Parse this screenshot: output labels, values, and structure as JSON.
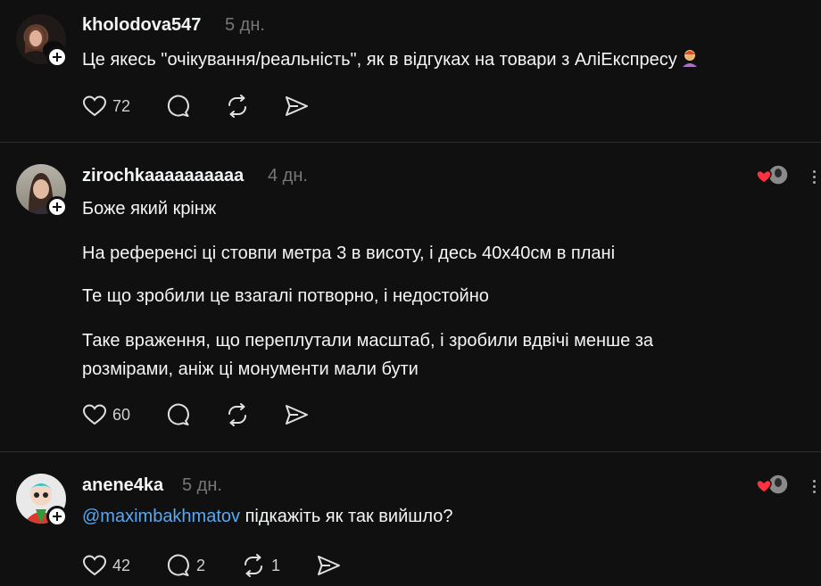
{
  "comments": [
    {
      "username": "kholodova547",
      "time": "5 дн.",
      "paragraphs": [
        "Це якесь \"очікування/реальність\", як в відгуках на товари з АліЕкспресу"
      ],
      "emoji": "facepalm-emoji",
      "likes": "72",
      "replies": "",
      "reposts": ""
    },
    {
      "username": "zirochkaaaaaaaaaa",
      "time": "4 дн.",
      "paragraphs": [
        "Боже який крінж",
        "На референсі ці стовпи метра 3 в висоту, і десь 40х40см в плані",
        "Те що зробили це взагалі потворно, і недостойно",
        "Таке враження, що переплутали масштаб, і зробили вдвічі менше за",
        "розмірами, аніж ці монументи мали бути"
      ],
      "likes": "60",
      "replies": "",
      "reposts": ""
    },
    {
      "username": "anene4ka",
      "time": "5 дн.",
      "mention": "@maximbakhmatov",
      "text": " підкажіть як так вийшло?",
      "likes": "42",
      "replies": "2",
      "reposts": "1"
    }
  ],
  "colors": {
    "background": "#101010",
    "text": "#f3f5f7",
    "muted": "#777777",
    "mention": "#5aa8f0",
    "heart": "#ff3040"
  }
}
